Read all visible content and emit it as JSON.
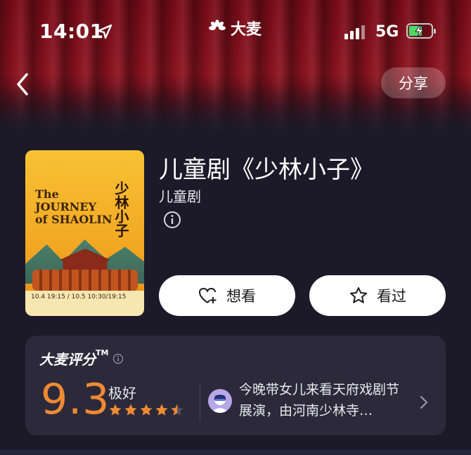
{
  "status_bar": {
    "time": "14:01",
    "network": "5G",
    "brand": "大麦"
  },
  "header": {
    "share_label": "分享"
  },
  "show": {
    "title": "儿童剧《少林小子》",
    "category": "儿童剧",
    "poster": {
      "title_en": "The JOURNEY of SHAOLIN",
      "title_zh": "少林小子",
      "dates": "10.4 19:15 / 10.5 10:30/19:15"
    }
  },
  "actions": {
    "want_label": "想看",
    "seen_label": "看过"
  },
  "rating": {
    "brand": "大麦评分",
    "trademark": "TM",
    "score": "9.3",
    "label": "极好",
    "stars": 4.5,
    "review_snippet": "今晚带女儿来看天府戏剧节展演，由河南少林寺…"
  },
  "colors": {
    "accent": "#f08a32",
    "background": "#1c1a29",
    "card": "#2c2a3a",
    "curtain": "#8e1420"
  },
  "icons": [
    "location-arrow-icon",
    "damai-logo-icon",
    "signal-icon",
    "battery-charging-icon",
    "back-chevron-icon",
    "info-icon",
    "heart-plus-icon",
    "star-outline-icon",
    "chevron-right-icon"
  ]
}
